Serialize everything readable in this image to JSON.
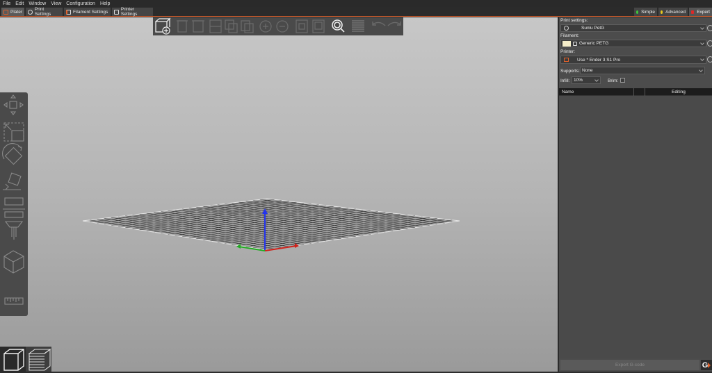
{
  "menu": [
    "File",
    "Edit",
    "Window",
    "View",
    "Configuration",
    "Help"
  ],
  "tabs": {
    "plater": "Plater",
    "print_settings": "Print Settings",
    "filament_settings": "Filament Settings",
    "printer_settings": "Printer Settings"
  },
  "modes": {
    "simple": "Simple",
    "advanced": "Advanced",
    "expert": "Expert",
    "simple_color": "#3cc83c",
    "advanced_color": "#e6c81e",
    "expert_color": "#dc2828"
  },
  "accent": "#e1612b",
  "panel": {
    "print_settings_label": "Print settings:",
    "print_settings_value": "Sunlu PetG",
    "filament_label": "Filament:",
    "filament_value": "Generic PETG",
    "printer_label": "Printer:",
    "printer_value": "Use * Ender 3 S1 Pro",
    "supports_label": "Supports:",
    "supports_value": "None",
    "infill_label": "Infill:",
    "infill_value": "10%",
    "brim_label": "Brim:",
    "brim_checked": false,
    "col_name": "Name",
    "col_editing": "Editing",
    "export_label": "Export G-code",
    "logo": "G"
  },
  "toolbar_icons": [
    "add-icon",
    "delete-icon",
    "delete-all-icon",
    "arrange-icon",
    "copy-icon",
    "paste-icon",
    "add-instance-icon",
    "remove-instance-icon",
    "split-objects-icon",
    "split-parts-icon",
    "search-icon",
    "layers-editing-icon",
    "undo-icon",
    "redo-icon"
  ],
  "left_tools": [
    "move-icon",
    "scale-icon",
    "rotate-icon",
    "place-on-face-icon",
    "cut-icon",
    "paint-supports-icon",
    "seam-painting-icon",
    "measure-icon"
  ],
  "view_tabs": [
    "3d-view-icon",
    "preview-icon"
  ]
}
